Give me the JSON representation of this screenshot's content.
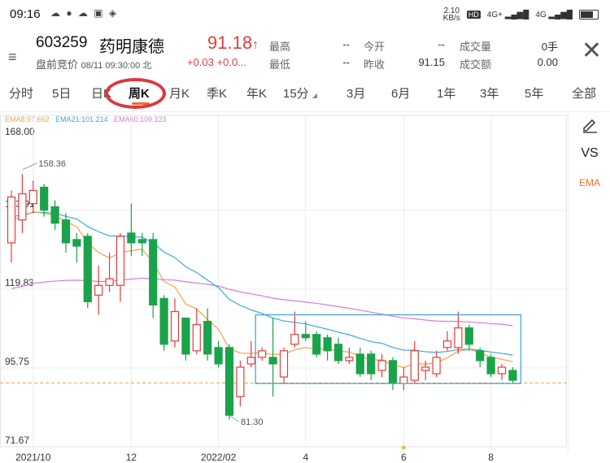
{
  "status_bar": {
    "time": "09:16",
    "notif_icons": "☁ ● ☁ ▣ ◈",
    "net_speed_top": "2.10",
    "net_speed_bottom": "KB/s",
    "signal1": "4G+",
    "signal2": "4G"
  },
  "stock": {
    "code": "603259",
    "name": "药明康德",
    "session": "盘前竞价",
    "time": "08/11 09:30:00 北",
    "price": "91.18",
    "price_arrow": "↑",
    "change": "+0.03",
    "change_pct": "+0.0..."
  },
  "quote": {
    "high_label": "最高",
    "high_value": "--",
    "low_label": "最低",
    "low_value": "--",
    "open_label": "今开",
    "open_value": "--",
    "prev_close_label": "昨收",
    "prev_close_value": "91.15",
    "volume_label": "成交量",
    "volume_value": "0手",
    "amount_label": "成交额",
    "amount_value": "0.00"
  },
  "tabs": [
    "分时",
    "5日",
    "日K",
    "周K",
    "月K",
    "季K",
    "年K",
    "15分",
    "3月",
    "6月",
    "1年",
    "3年",
    "5年",
    "全部"
  ],
  "active_tab": "周K",
  "ema_legend": {
    "ema8": "EMA8:97.662",
    "ema21": "EMA21:101.214",
    "ema60": "EMA60:109.123"
  },
  "side_panel": {
    "edit_icon": "pencil-icon",
    "vs_label": "VS",
    "ema_label": "EMA"
  },
  "colors": {
    "up": "#e83a3a",
    "down": "#1aa34a",
    "ema8": "#f0a24a",
    "ema21": "#3aa8e0",
    "ema60": "#d77ce0",
    "highlight_box": "#4aa6e0",
    "annotation_circle": "#e0353f",
    "tab_underline": "#e8742a"
  },
  "chart_data": {
    "type": "candlestick",
    "y_ticks": [
      "168.00",
      "143.91",
      "119.83",
      "95.75",
      "71.67"
    ],
    "ylim": [
      71.67,
      168.0
    ],
    "x_labels": [
      {
        "label": "2021/10",
        "index": 2
      },
      {
        "label": "12",
        "index": 11
      },
      {
        "label": "2022/02",
        "index": 19
      },
      {
        "label": "4",
        "index": 27
      },
      {
        "label": "6",
        "index": 36
      },
      {
        "label": "8",
        "index": 44
      }
    ],
    "max_annotation": {
      "label": "158.36",
      "index": 1,
      "value": 158.36
    },
    "min_annotation": {
      "label": "81.30",
      "index": 20,
      "value": 81.3
    },
    "reference_price": 91.15,
    "highlight_range": {
      "from_index": 23,
      "to_index": 46,
      "top": 112,
      "bottom": 91
    },
    "candles": [
      {
        "o": 134,
        "c": 148,
        "h": 150,
        "l": 128
      },
      {
        "o": 141,
        "c": 149,
        "h": 155,
        "l": 137
      },
      {
        "o": 146,
        "c": 150,
        "h": 153,
        "l": 143
      },
      {
        "o": 151,
        "c": 144,
        "h": 152,
        "l": 142
      },
      {
        "o": 145,
        "c": 140,
        "h": 147,
        "l": 138
      },
      {
        "o": 141,
        "c": 134,
        "h": 143,
        "l": 131
      },
      {
        "o": 135,
        "c": 133,
        "h": 137,
        "l": 128
      },
      {
        "o": 136,
        "c": 116,
        "h": 137,
        "l": 114
      },
      {
        "o": 118,
        "c": 121,
        "h": 127,
        "l": 112
      },
      {
        "o": 121,
        "c": 123,
        "h": 131,
        "l": 119
      },
      {
        "o": 121,
        "c": 136,
        "h": 137,
        "l": 116
      },
      {
        "o": 137,
        "c": 134,
        "h": 146,
        "l": 130
      },
      {
        "o": 135,
        "c": 134,
        "h": 137,
        "l": 130
      },
      {
        "o": 135,
        "c": 115,
        "h": 137,
        "l": 111
      },
      {
        "o": 117,
        "c": 103,
        "h": 118,
        "l": 101
      },
      {
        "o": 104,
        "c": 113,
        "h": 117,
        "l": 102
      },
      {
        "o": 111,
        "c": 100,
        "h": 111,
        "l": 98
      },
      {
        "o": 101,
        "c": 109,
        "h": 114,
        "l": 100
      },
      {
        "o": 110,
        "c": 100,
        "h": 114,
        "l": 98
      },
      {
        "o": 102,
        "c": 97,
        "h": 104,
        "l": 96
      },
      {
        "o": 102,
        "c": 81.3,
        "h": 103,
        "l": 80
      },
      {
        "o": 87,
        "c": 96,
        "h": 98,
        "l": 84
      },
      {
        "o": 97,
        "c": 99,
        "h": 104,
        "l": 96
      },
      {
        "o": 99,
        "c": 101,
        "h": 102,
        "l": 98
      },
      {
        "o": 99,
        "c": 97,
        "h": 111,
        "l": 87
      },
      {
        "o": 93,
        "c": 101,
        "h": 102,
        "l": 91
      },
      {
        "o": 103,
        "c": 106,
        "h": 113,
        "l": 102
      },
      {
        "o": 106,
        "c": 105,
        "h": 110,
        "l": 104
      },
      {
        "o": 106,
        "c": 100,
        "h": 107,
        "l": 99
      },
      {
        "o": 105,
        "c": 101,
        "h": 106,
        "l": 98
      },
      {
        "o": 103,
        "c": 98,
        "h": 105,
        "l": 97
      },
      {
        "o": 98,
        "c": 99,
        "h": 102,
        "l": 97
      },
      {
        "o": 100,
        "c": 94,
        "h": 102,
        "l": 93
      },
      {
        "o": 100,
        "c": 94,
        "h": 101,
        "l": 92
      },
      {
        "o": 95,
        "c": 98,
        "h": 100,
        "l": 93
      },
      {
        "o": 98,
        "c": 91,
        "h": 99,
        "l": 89
      },
      {
        "o": 91,
        "c": 93,
        "h": 96,
        "l": 89
      },
      {
        "o": 92,
        "c": 101,
        "h": 104,
        "l": 91
      },
      {
        "o": 95,
        "c": 96,
        "h": 98,
        "l": 92
      },
      {
        "o": 94,
        "c": 99,
        "h": 101,
        "l": 93
      },
      {
        "o": 102,
        "c": 104,
        "h": 107,
        "l": 101
      },
      {
        "o": 102,
        "c": 108,
        "h": 113,
        "l": 100
      },
      {
        "o": 108,
        "c": 103,
        "h": 109,
        "l": 101
      },
      {
        "o": 101,
        "c": 98,
        "h": 102,
        "l": 96
      },
      {
        "o": 99,
        "c": 94,
        "h": 100,
        "l": 93
      },
      {
        "o": 94,
        "c": 96,
        "h": 97,
        "l": 92
      },
      {
        "o": 95,
        "c": 92,
        "h": 96,
        "l": 91
      }
    ],
    "ema8": [
      141,
      142,
      143.5,
      143,
      142.4,
      140.5,
      138.9,
      134,
      131,
      129.4,
      131,
      131.6,
      132.1,
      128,
      122.2,
      120.5,
      115.3,
      113.8,
      110.5,
      107.6,
      101.7,
      100.3,
      100.2,
      100.4,
      99.8,
      100.1,
      101.3,
      102,
      101.6,
      101.5,
      101,
      100.6,
      99.3,
      98.2,
      98.2,
      96.6,
      95.9,
      97.1,
      96.9,
      97.4,
      98.9,
      100.9,
      101.4,
      100.5,
      99,
      98.4,
      97.7
    ],
    "ema21": [
      142,
      142.5,
      143.3,
      143.3,
      143,
      142.1,
      141.3,
      139,
      137.4,
      136.1,
      136.1,
      135.9,
      135.7,
      134,
      131.2,
      129.5,
      126.7,
      124.9,
      122.6,
      120.3,
      116.7,
      114.9,
      113.5,
      112.4,
      111,
      110.1,
      109.7,
      109.2,
      108.4,
      107.6,
      106.7,
      105.9,
      104.8,
      103.8,
      103.3,
      102,
      101.2,
      101.2,
      100.7,
      100.5,
      100.8,
      101.4,
      101.5,
      101.2,
      100.6,
      100.2,
      99.7
    ],
    "ema60": [
      120,
      120.7,
      121.6,
      122,
      122.3,
      122.5,
      122.6,
      122.4,
      122.2,
      122.2,
      122.6,
      122.9,
      123.2,
      123,
      122.7,
      122.6,
      122.1,
      121.7,
      121.3,
      120.8,
      119.8,
      119,
      118.4,
      117.8,
      117.1,
      116.6,
      116.3,
      115.9,
      115.5,
      115,
      114.5,
      114,
      113.4,
      112.8,
      112.2,
      111.6,
      111,
      110.8,
      110.4,
      110.1,
      110,
      110,
      109.8,
      109.6,
      109.3,
      109.1,
      108.7
    ]
  }
}
